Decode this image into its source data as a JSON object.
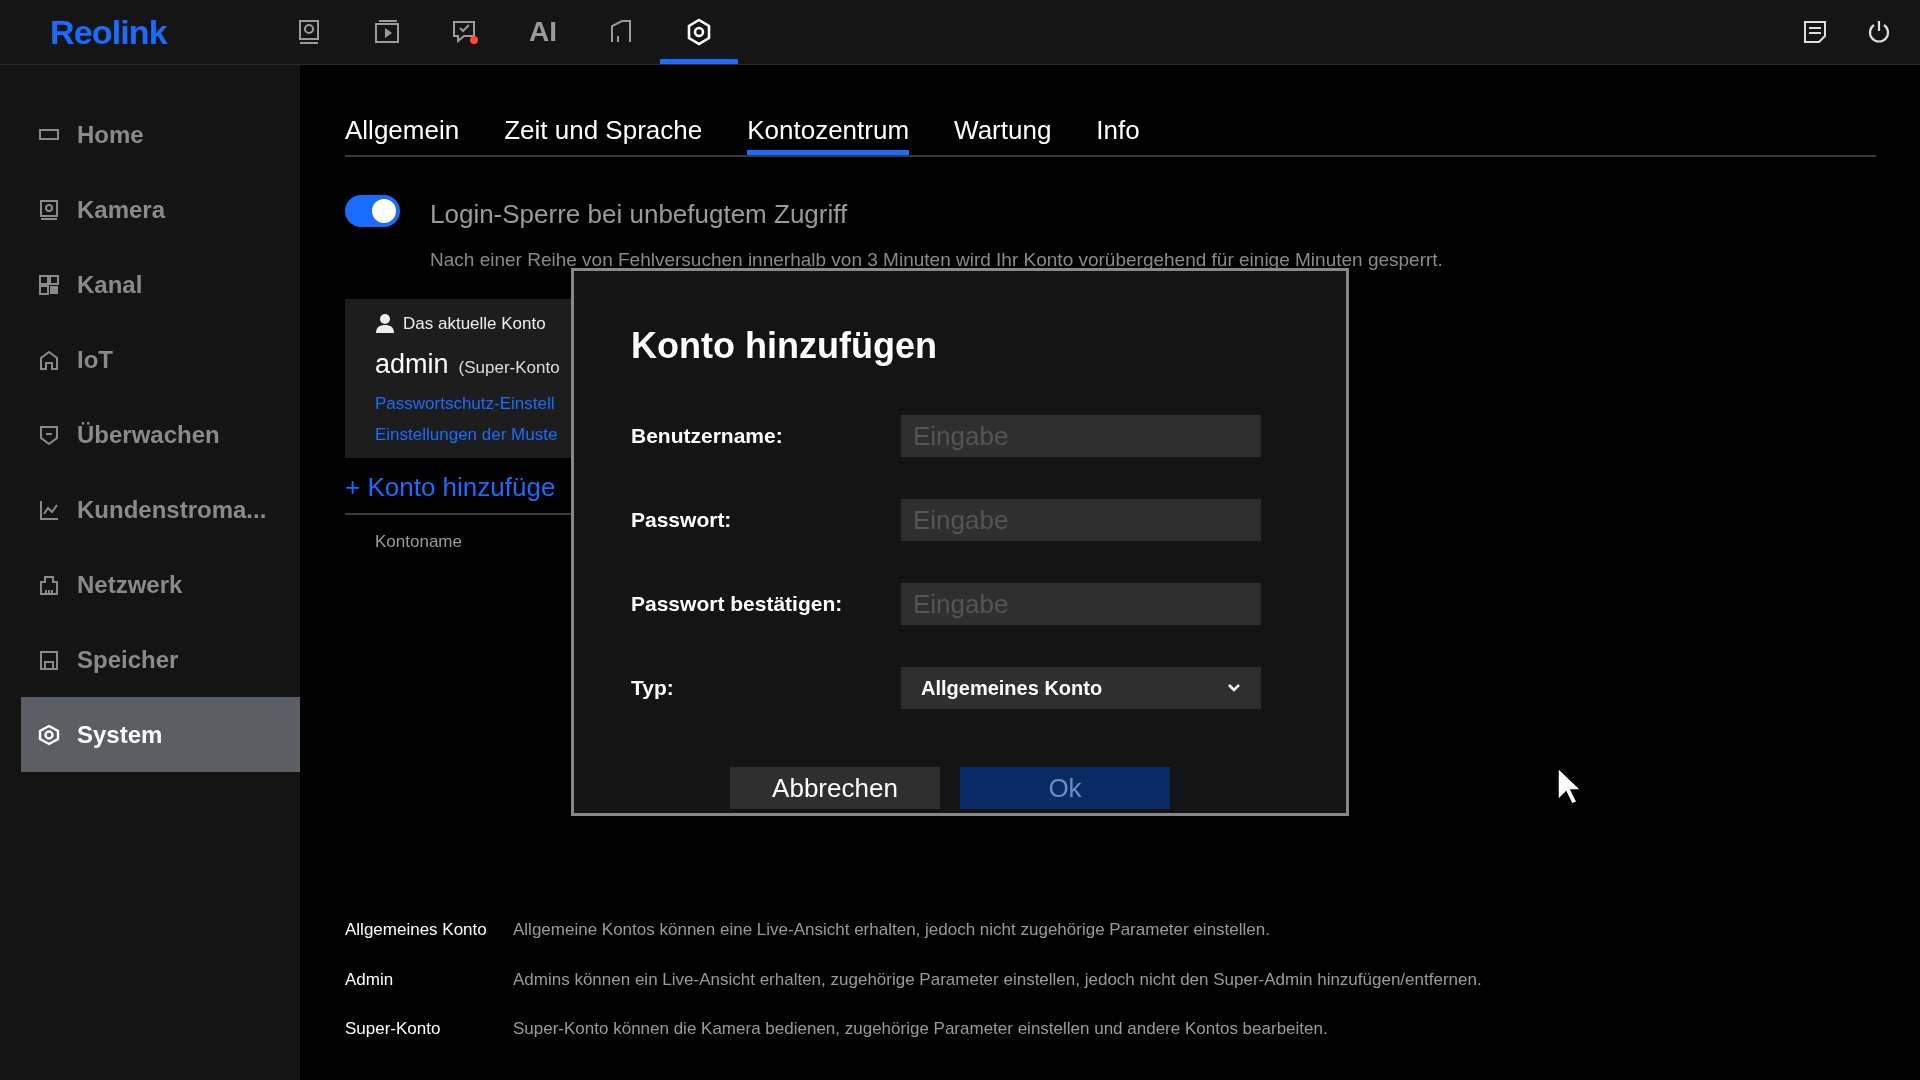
{
  "logo": "Reolink",
  "top_nav": [
    {
      "selected": false
    },
    {
      "selected": false
    },
    {
      "selected": false,
      "badge": true
    },
    {
      "label": "AI",
      "selected": false
    },
    {
      "selected": false
    },
    {
      "selected": true
    }
  ],
  "sidebar": {
    "items": [
      {
        "label": "Home",
        "selected": false
      },
      {
        "label": "Kamera",
        "selected": false
      },
      {
        "label": "Kanal",
        "selected": false
      },
      {
        "label": "IoT",
        "selected": false
      },
      {
        "label": "Überwachen",
        "selected": false
      },
      {
        "label": "Kundenstroma...",
        "selected": false
      },
      {
        "label": "Netzwerk",
        "selected": false
      },
      {
        "label": "Speicher",
        "selected": false
      },
      {
        "label": "System",
        "selected": true
      }
    ]
  },
  "tabs": [
    {
      "label": "Allgemein",
      "selected": false
    },
    {
      "label": "Zeit und Sprache",
      "selected": false
    },
    {
      "label": "Kontozentrum",
      "selected": true
    },
    {
      "label": "Wartung",
      "selected": false
    },
    {
      "label": "Info",
      "selected": false
    }
  ],
  "login_lock": {
    "on": true,
    "title": "Login-Sperre bei unbefugtem Zugriff",
    "description": "Nach einer Reihe von Fehlversuchen innerhalb von 3 Minuten wird Ihr Konto vorübergehend für einige Minuten gesperrt."
  },
  "current_account": {
    "heading": "Das aktuelle Konto",
    "name": "admin",
    "role": "(Super-Konto",
    "links": [
      "Passwortschutz-Einstell",
      "Einstellungen der Muste"
    ]
  },
  "add_account_link": "+ Konto hinzufüge",
  "table": {
    "columns": [
      "Kontoname"
    ]
  },
  "account_types": [
    {
      "name": "Allgemeines Konto",
      "description": "Allgemeine Kontos können eine Live-Ansicht erhalten, jedoch nicht zugehörige Parameter einstellen."
    },
    {
      "name": "Admin",
      "description": "Admins können ein Live-Ansicht erhalten, zugehörige Parameter einstellen, jedoch nicht den Super-Admin hinzufügen/entfernen."
    },
    {
      "name": "Super-Konto",
      "description": "Super-Konto können die Kamera bedienen, zugehörige Parameter einstellen und andere Kontos bearbeiten."
    }
  ],
  "dialog": {
    "title": "Konto hinzufügen",
    "fields": [
      {
        "kind": "input",
        "label": "Benutzername:",
        "placeholder": "Eingabe"
      },
      {
        "kind": "input",
        "label": "Passwort:",
        "placeholder": "Eingabe"
      },
      {
        "kind": "input",
        "label": "Passwort bestätigen:",
        "placeholder": "Eingabe"
      },
      {
        "kind": "select",
        "label": "Typ:",
        "value": "Allgemeines Konto"
      }
    ],
    "buttons": [
      {
        "label": "Abbrechen",
        "disabled": false
      },
      {
        "label": "Ok",
        "disabled": true
      }
    ]
  }
}
